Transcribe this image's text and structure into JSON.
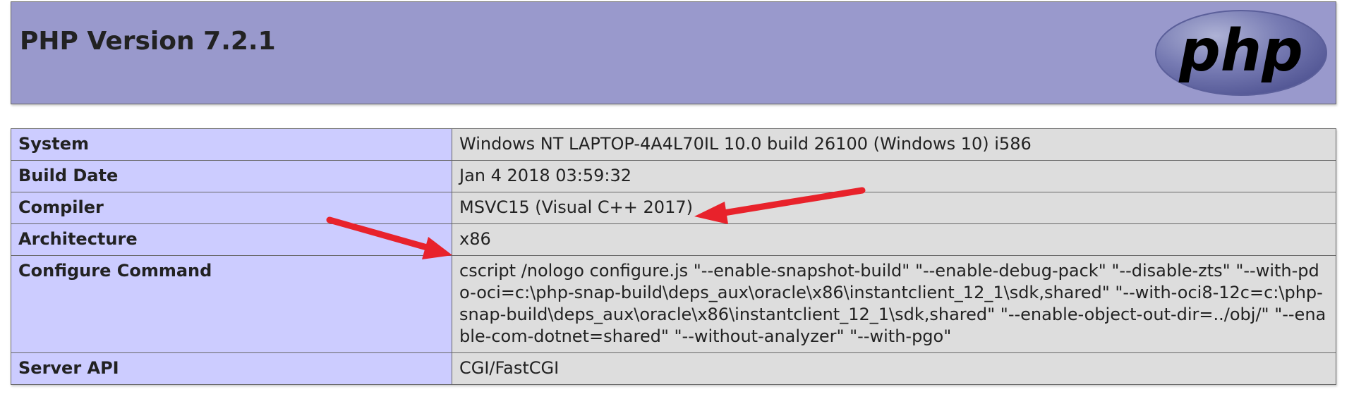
{
  "header": {
    "title": "PHP Version 7.2.1",
    "logo_text": "php",
    "colors": {
      "header_bg": "#9999cc",
      "key_bg": "#ccccff",
      "value_bg": "#dddddd",
      "logo_bg": "#777bb3",
      "arrow": "#e8222b"
    }
  },
  "info_table": {
    "rows": [
      {
        "key": "System",
        "value": "Windows NT LAPTOP-4A4L70IL 10.0 build 26100 (Windows 10) i586"
      },
      {
        "key": "Build Date",
        "value": "Jan 4 2018 03:59:32"
      },
      {
        "key": "Compiler",
        "value": "MSVC15 (Visual C++ 2017)"
      },
      {
        "key": "Architecture",
        "value": "x86"
      },
      {
        "key": "Configure Command",
        "value": "cscript /nologo configure.js \"--enable-snapshot-build\" \"--enable-debug-pack\" \"--disable-zts\" \"--with-pdo-oci=c:\\php-snap-build\\deps_aux\\oracle\\x86\\instantclient_12_1\\sdk,shared\" \"--with-oci8-12c=c:\\php-snap-build\\deps_aux\\oracle\\x86\\instantclient_12_1\\sdk,shared\" \"--enable-object-out-dir=../obj/\" \"--enable-com-dotnet=shared\" \"--without-analyzer\" \"--with-pgo\""
      },
      {
        "key": "Server API",
        "value": "CGI/FastCGI"
      }
    ]
  },
  "annotations": {
    "icons": [
      "red-arrow-icon",
      "red-arrow-icon"
    ]
  }
}
